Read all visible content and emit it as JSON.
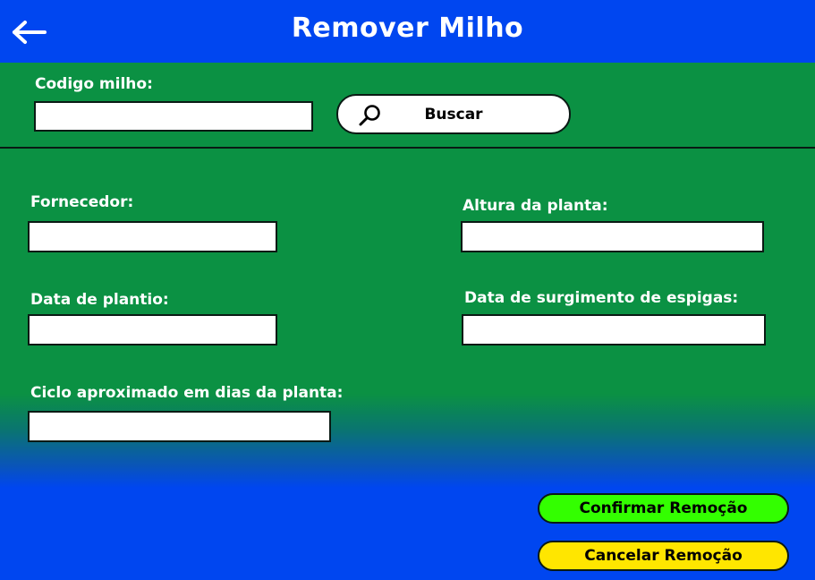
{
  "header": {
    "title": "Remover Milho",
    "back_icon": "arrow-left-icon"
  },
  "search": {
    "label": "Codigo milho:",
    "value": "",
    "button_label": "Buscar",
    "button_icon": "magnifier-icon"
  },
  "fields": {
    "fornecedor": {
      "label": "Fornecedor:",
      "value": ""
    },
    "altura": {
      "label": "Altura da planta:",
      "value": ""
    },
    "data_plantio": {
      "label": "Data de plantio:",
      "value": ""
    },
    "data_espigas": {
      "label": "Data de surgimento de espigas:",
      "value": ""
    },
    "ciclo": {
      "label": "Ciclo aproximado em dias da planta:",
      "value": ""
    }
  },
  "actions": {
    "confirm_label": "Confirmar Remoção",
    "cancel_label": "Cancelar Remoção"
  },
  "colors": {
    "header_blue": "#0046f0",
    "form_green": "#0b9143",
    "confirm_green": "#33ff00",
    "cancel_yellow": "#ffe600"
  }
}
